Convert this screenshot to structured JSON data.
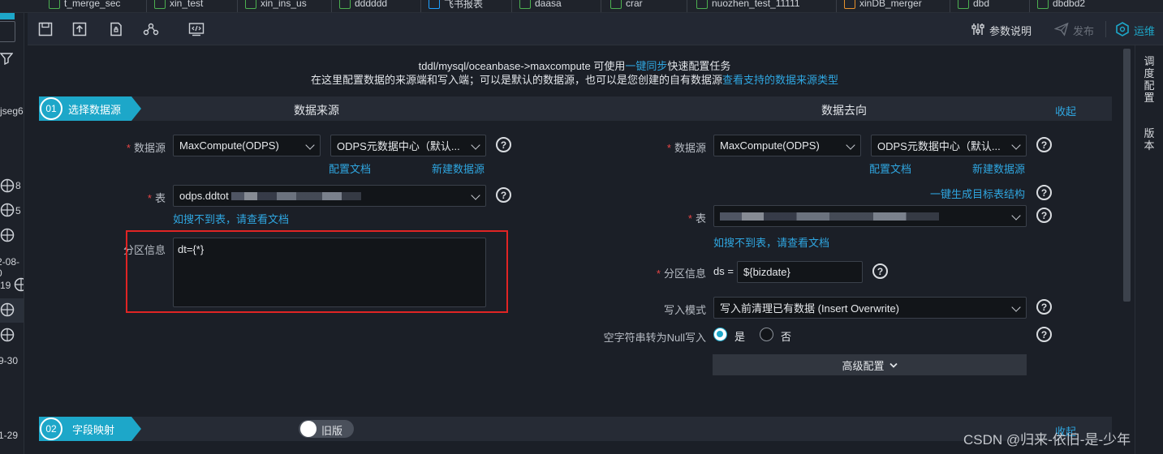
{
  "tabs": [
    {
      "label": "t_merge_sec"
    },
    {
      "label": "xin_test"
    },
    {
      "label": "xin_ins_us"
    },
    {
      "label": "dddddd"
    },
    {
      "label": "飞书报表"
    },
    {
      "label": "daasa"
    },
    {
      "label": "crar"
    },
    {
      "label": "nuozhen_test_11111"
    },
    {
      "label": "xinDB_merger"
    },
    {
      "label": "dbd"
    },
    {
      "label": "dbdbd2"
    }
  ],
  "left_sidebar": {
    "labels": [
      "jseg6",
      "8",
      "5",
      "2-08-0",
      "19",
      "9-30",
      "1-29"
    ]
  },
  "toolbar": {
    "param_doc": "参数说明",
    "publish": "发布",
    "ops": "运维"
  },
  "right_rail": {
    "schedule_config": "调度配置",
    "version": "版本"
  },
  "notice": {
    "line1_pre": "tddl/mysql/oceanbase->maxcompute 可使用",
    "line1_link": "一键同步",
    "line1_post": "快速配置任务",
    "line2_pre": "在这里配置数据的来源端和写入端；可以是默认的数据源，也可以是您创建的自有数据源",
    "line2_link": "查看支持的数据来源类型"
  },
  "step1": {
    "number": "01",
    "title": "选择数据源",
    "source_heading": "数据来源",
    "target_heading": "数据去向",
    "collapse": "收起"
  },
  "source": {
    "datasource_label": "数据源",
    "datasource_type": "MaxCompute(ODPS)",
    "datasource_name": "ODPS元数据中心（默认...",
    "config_doc": "配置文档",
    "new_datasource": "新建数据源",
    "table_label": "表",
    "table_value_prefix": "odps.ddtot",
    "table_not_found": "如搜不到表，请查看文档",
    "partition_label": "分区信息",
    "partition_value": "dt={*}"
  },
  "target": {
    "datasource_label": "数据源",
    "datasource_type": "MaxCompute(ODPS)",
    "datasource_name": "ODPS元数据中心（默认...",
    "config_doc": "配置文档",
    "new_datasource": "新建数据源",
    "gen_table": "一键生成目标表结构",
    "table_label": "表",
    "table_not_found": "如搜不到表，请查看文档",
    "partition_label": "分区信息",
    "partition_key": "ds =",
    "partition_value": "${bizdate}",
    "write_mode_label": "写入模式",
    "write_mode_value": "写入前清理已有数据 (Insert Overwrite)",
    "empty_null_label": "空字符串转为Null写入",
    "yes": "是",
    "no": "否",
    "advanced": "高级配置"
  },
  "step2": {
    "number": "02",
    "title": "字段映射",
    "toggle_label": "旧版",
    "collapse": "收起"
  },
  "watermark": "CSDN @归来-依旧-是-少年",
  "colors": {
    "accent": "#1da7c9",
    "link": "#2fa6e0",
    "required": "#e64545",
    "highlight_box": "#e02424"
  }
}
